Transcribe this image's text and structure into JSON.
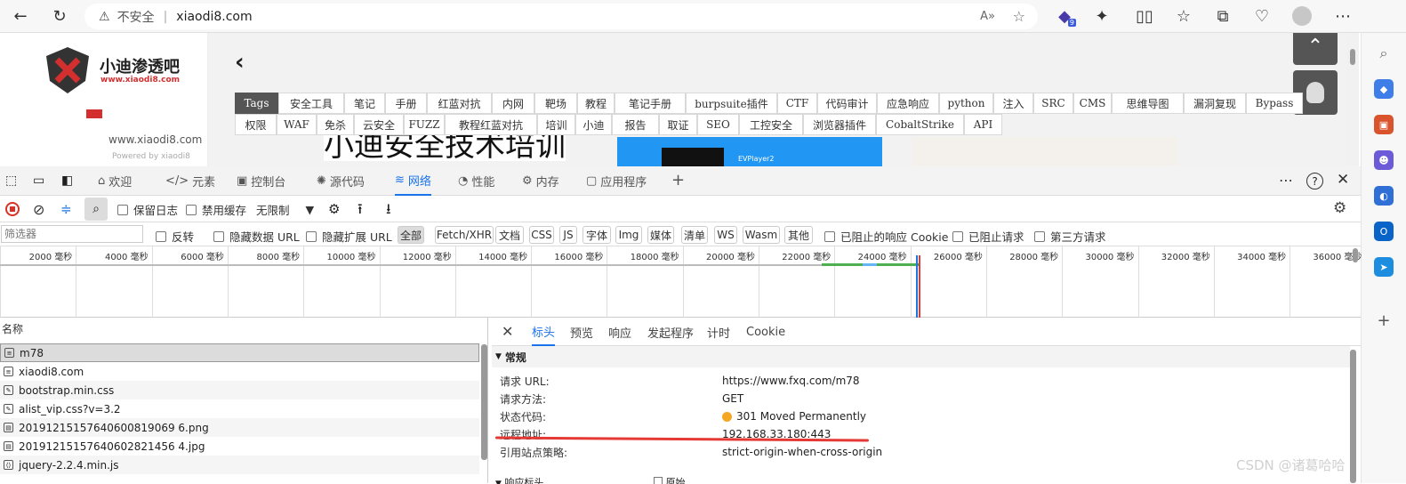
{
  "browser": {
    "security_label": "不安全",
    "url": "xiaodi8.com",
    "extension_badge": "9"
  },
  "site": {
    "logo_text": "小迪渗透吧",
    "logo_url": "www.xiaodi8.com",
    "domain_text": "www.xiaodi8.com",
    "powered": "Powered by xiaodi8",
    "banner_heading": "小迪安全技术培训",
    "player_label": "EVPlayer2",
    "tags_row1": [
      "Tags",
      "安全工具",
      "笔记",
      "手册",
      "红蓝对抗",
      "内网",
      "靶场",
      "教程",
      "笔记手册",
      "burpsuite插件",
      "CTF",
      "代码审计",
      "应急响应",
      "python",
      "注入",
      "SRC",
      "CMS",
      "思维导图",
      "漏洞复现",
      "Bypass"
    ],
    "tags_row2": [
      "权限",
      "WAF",
      "免杀",
      "云安全",
      "FUZZ",
      "教程红蓝对抗",
      "培训",
      "小迪",
      "报告",
      "取证",
      "SEO",
      "工控安全",
      "浏览器插件",
      "CobaltStrike",
      "API"
    ]
  },
  "devtools": {
    "tabs": [
      "欢迎",
      "元素",
      "控制台",
      "源代码",
      "网络",
      "性能",
      "内存",
      "应用程序"
    ],
    "active_tab": "网络",
    "toolbar": {
      "preserve_log": "保留日志",
      "disable_cache": "禁用缓存",
      "throttle": "无限制"
    },
    "filter": {
      "placeholder": "筛选器",
      "invert": "反转",
      "hide_data_url": "隐藏数据 URL",
      "hide_ext_url": "隐藏扩展 URL",
      "types": [
        "全部",
        "Fetch/XHR",
        "文档",
        "CSS",
        "JS",
        "字体",
        "Img",
        "媒体",
        "清单",
        "WS",
        "Wasm",
        "其他"
      ],
      "blocked_cookies": "已阻止的响应 Cookie",
      "blocked_requests": "已阻止请求",
      "third_party": "第三方请求"
    },
    "timeline_ticks": [
      "2000 毫秒",
      "4000 毫秒",
      "6000 毫秒",
      "8000 毫秒",
      "10000 毫秒",
      "12000 毫秒",
      "14000 毫秒",
      "16000 毫秒",
      "18000 毫秒",
      "20000 毫秒",
      "22000 毫秒",
      "24000 毫秒",
      "26000 毫秒",
      "28000 毫秒",
      "30000 毫秒",
      "32000 毫秒",
      "34000 毫秒",
      "36000 毫秒"
    ],
    "list_header": "名称",
    "requests": [
      "m78",
      "xiaodi8.com",
      "bootstrap.min.css",
      "alist_vip.css?v=3.2",
      "20191215157640600819069 6.png",
      "20191215157640602821456 4.jpg",
      "jquery-2.2.4.min.js"
    ],
    "detail_tabs": [
      "标头",
      "预览",
      "响应",
      "发起程序",
      "计时",
      "Cookie"
    ],
    "section_general": "常规",
    "general": [
      {
        "key": "请求 URL:",
        "value": "https://www.fxq.com/m78"
      },
      {
        "key": "请求方法:",
        "value": "GET"
      },
      {
        "key": "状态代码:",
        "value": "301 Moved Permanently"
      },
      {
        "key": "远程地址:",
        "value": "192.168.33.180:443"
      },
      {
        "key": "引用站点策略:",
        "value": "strict-origin-when-cross-origin"
      }
    ],
    "next_section": "响应标头",
    "raw_label": "原始"
  },
  "watermark": "CSDN @诸葛哈哈",
  "colors": {
    "accent": "#1a73e8",
    "status_dot": "#f5a623",
    "annotation_line": "#e53935"
  }
}
